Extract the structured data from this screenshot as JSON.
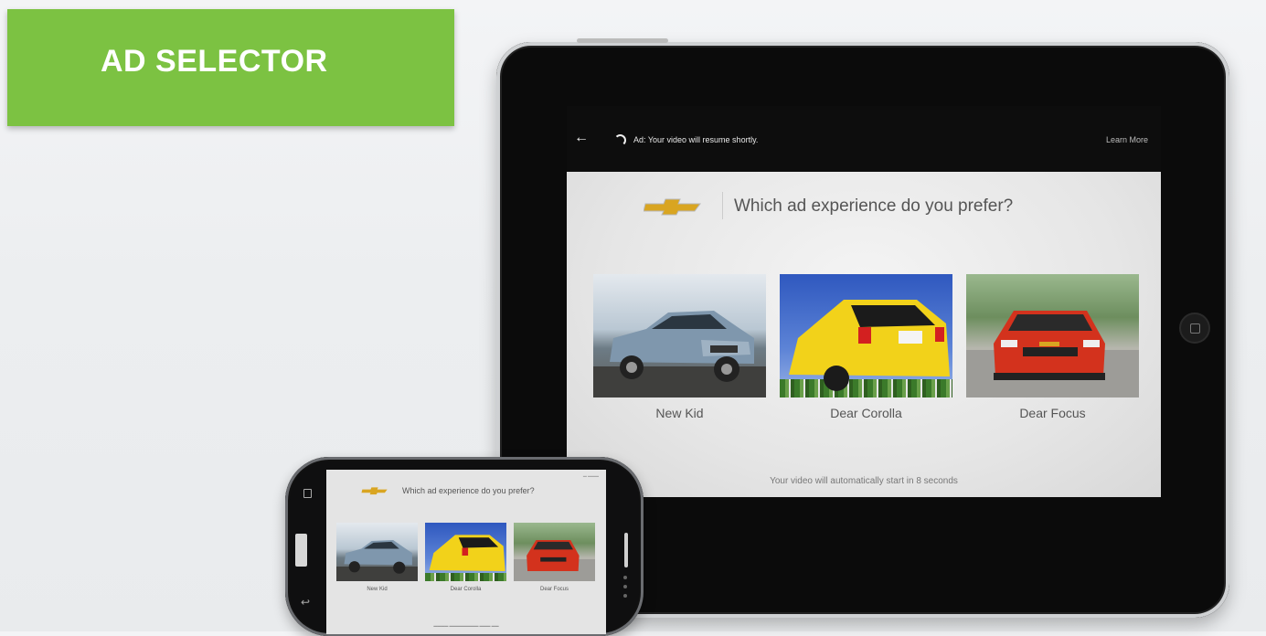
{
  "banner": {
    "title": "AD SELECTOR"
  },
  "tablet": {
    "status_text": "Ad: Your video will resume shortly.",
    "learn_more": "Learn More",
    "question": "Which ad experience do you prefer?",
    "options": [
      {
        "label": "New Kid"
      },
      {
        "label": "Dear Corolla"
      },
      {
        "label": "Dear Focus"
      }
    ],
    "countdown": "Your video will automatically start in 8 seconds"
  },
  "phone": {
    "question": "Which ad experience do you prefer?",
    "options": [
      {
        "label": "New Kid"
      },
      {
        "label": "Dear Corolla"
      },
      {
        "label": "Dear Focus"
      }
    ]
  },
  "colors": {
    "banner_green": "#7cc242",
    "chevy_gold": "#d9a521"
  },
  "icons": [
    "back-arrow-icon",
    "loading-spinner-icon",
    "chevrolet-logo-icon",
    "home-button-icon",
    "menu-icon",
    "back-icon"
  ]
}
